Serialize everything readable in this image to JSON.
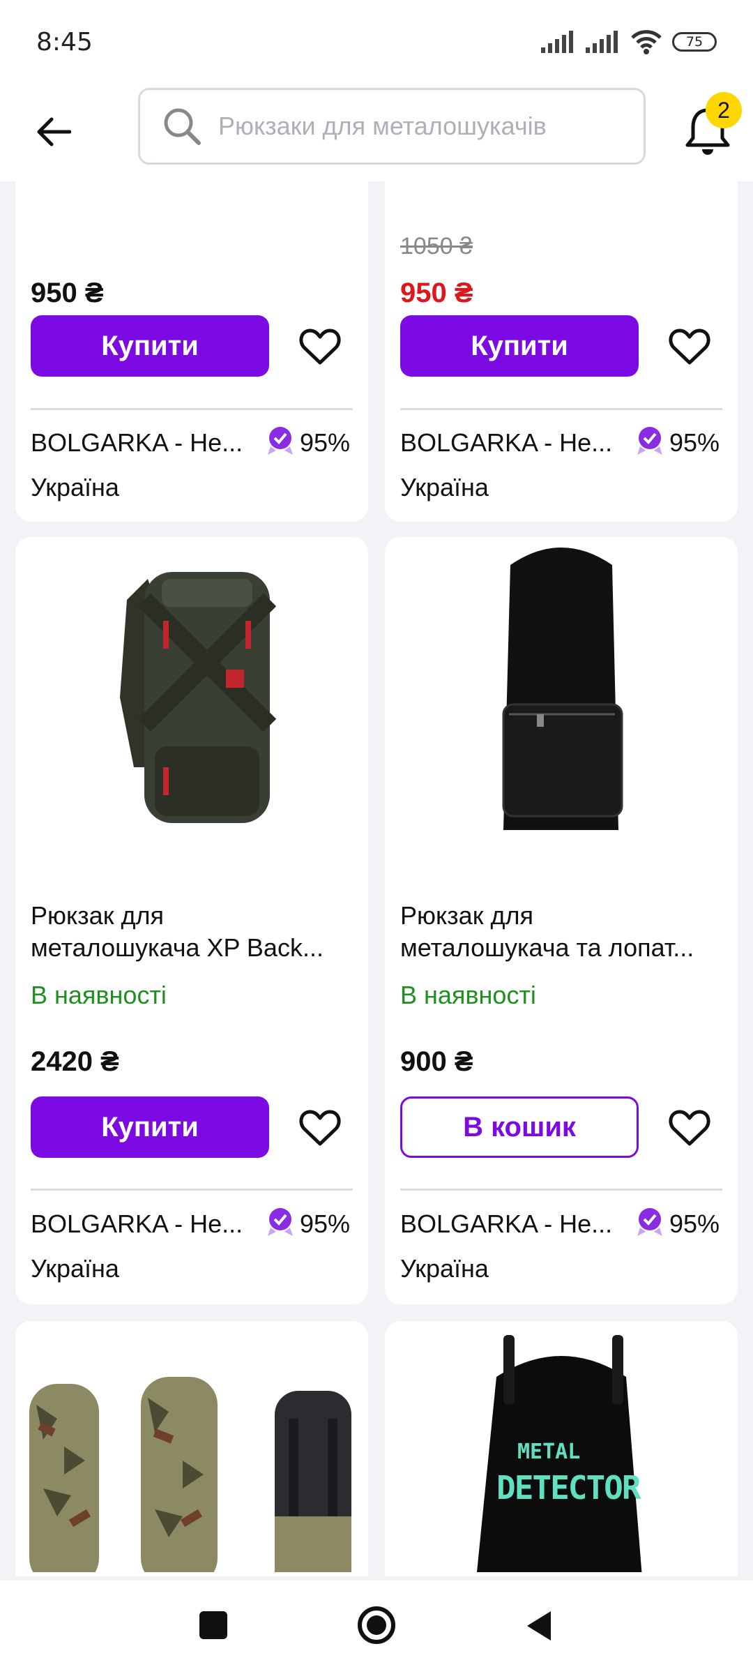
{
  "status_bar": {
    "time": "8:45",
    "battery": "75"
  },
  "header": {
    "search_placeholder": "Рюкзаки для металошукачів",
    "notifications_count": "2"
  },
  "colors": {
    "accent": "#7b0be2",
    "sale": "#e0161b",
    "in_stock": "#1f8f1f",
    "badge": "#ffd600"
  },
  "products": [
    {
      "old_price": "",
      "price": "950 ₴",
      "action": "Купити",
      "seller": "BOLGARKA -  Не...",
      "rating": "95%",
      "country": "Україна"
    },
    {
      "old_price": "1050 ₴",
      "price": "950 ₴",
      "action": "Купити",
      "seller": "BOLGARKA -  Не...",
      "rating": "95%",
      "country": "Україна"
    },
    {
      "title_line1": "Рюкзак для",
      "title_line2": "металошукача XP Back...",
      "stock": "В наявності",
      "price": "2420 ₴",
      "action": "Купити",
      "seller": "BOLGARKA -  Не...",
      "rating": "95%",
      "country": "Україна"
    },
    {
      "title_line1": "Рюкзак для",
      "title_line2": "металошукача та лопат...",
      "stock": "В наявності",
      "price": "900 ₴",
      "action": "В кошик",
      "seller": "BOLGARKA -  Не...",
      "rating": "95%",
      "country": "Україна"
    },
    {
      "image": "camouflage-backpacks"
    },
    {
      "image_text_line1": "METAL",
      "image_text_line2": "DETECTOR"
    }
  ]
}
